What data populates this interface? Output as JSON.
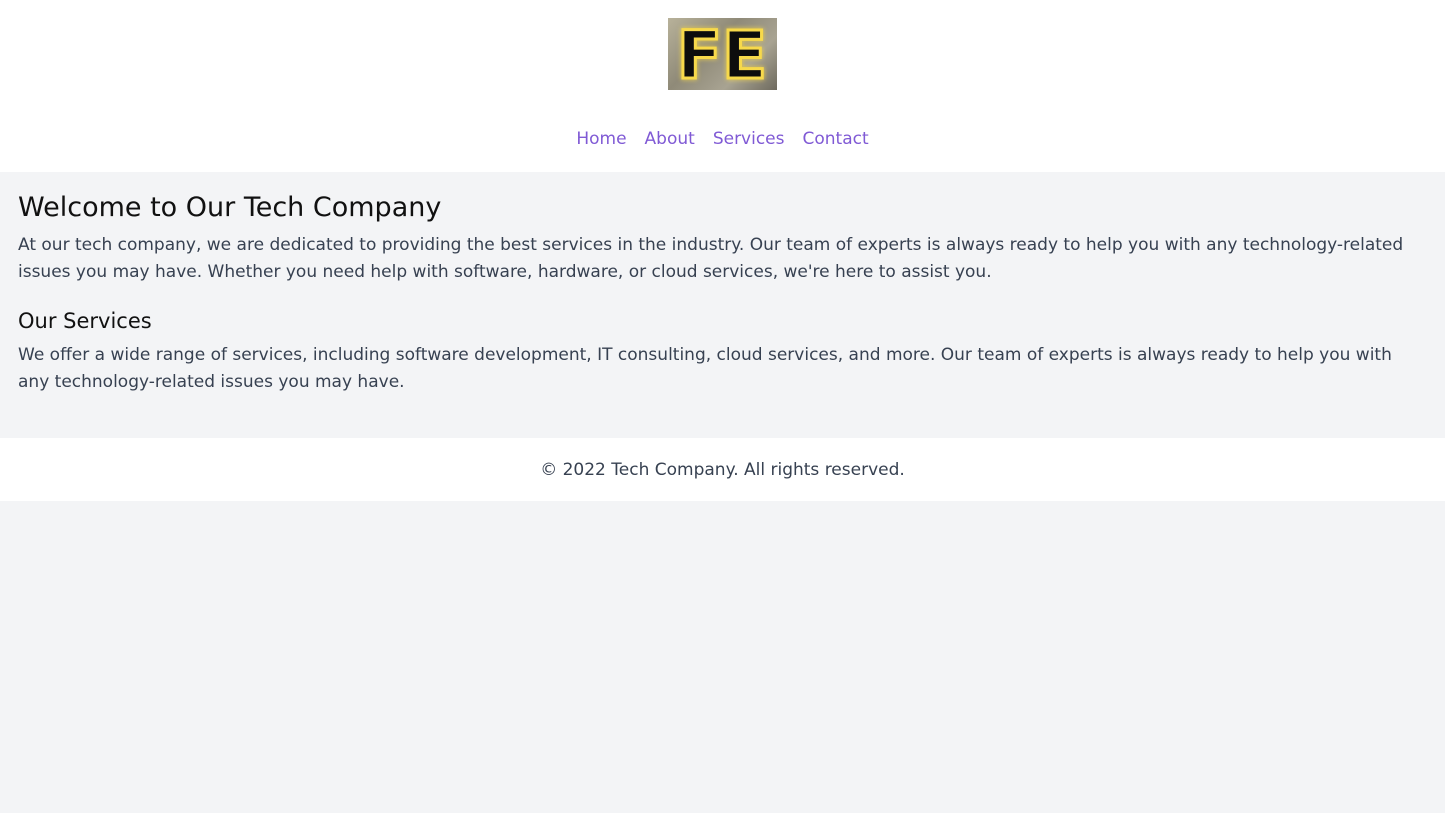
{
  "header": {
    "logo_text": "FE",
    "nav": [
      {
        "label": "Home"
      },
      {
        "label": "About"
      },
      {
        "label": "Services"
      },
      {
        "label": "Contact"
      }
    ]
  },
  "main": {
    "title": "Welcome to Our Tech Company",
    "intro": "At our tech company, we are dedicated to providing the best services in the industry. Our team of experts is always ready to help you with any technology-related issues you may have. Whether you need help with software, hardware, or cloud services, we're here to assist you.",
    "services_heading": "Our Services",
    "services_text": "We offer a wide range of services, including software development, IT consulting, cloud services, and more. Our team of experts is always ready to help you with any technology-related issues you may have."
  },
  "footer": {
    "copyright": "© 2022 Tech Company. All rights reserved."
  },
  "colors": {
    "link": "#805ad5",
    "page_bg": "#f3f4f6",
    "surface": "#ffffff",
    "text": "#374151"
  }
}
